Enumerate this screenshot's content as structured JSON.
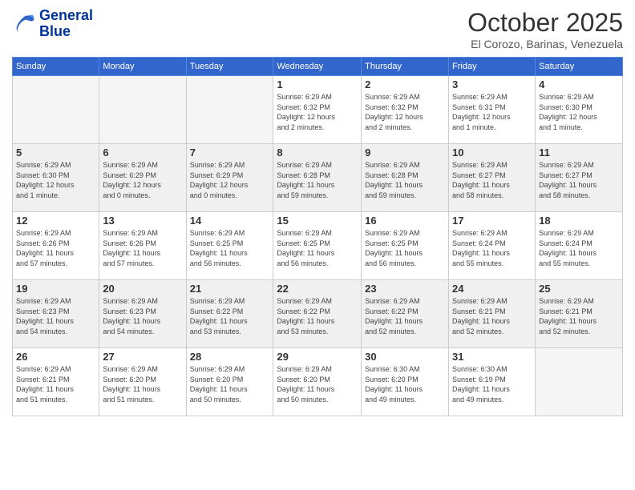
{
  "header": {
    "logo_line1": "General",
    "logo_line2": "Blue",
    "month": "October 2025",
    "location": "El Corozo, Barinas, Venezuela"
  },
  "days_of_week": [
    "Sunday",
    "Monday",
    "Tuesday",
    "Wednesday",
    "Thursday",
    "Friday",
    "Saturday"
  ],
  "weeks": [
    [
      {
        "day": "",
        "info": ""
      },
      {
        "day": "",
        "info": ""
      },
      {
        "day": "",
        "info": ""
      },
      {
        "day": "1",
        "info": "Sunrise: 6:29 AM\nSunset: 6:32 PM\nDaylight: 12 hours\nand 2 minutes."
      },
      {
        "day": "2",
        "info": "Sunrise: 6:29 AM\nSunset: 6:32 PM\nDaylight: 12 hours\nand 2 minutes."
      },
      {
        "day": "3",
        "info": "Sunrise: 6:29 AM\nSunset: 6:31 PM\nDaylight: 12 hours\nand 1 minute."
      },
      {
        "day": "4",
        "info": "Sunrise: 6:29 AM\nSunset: 6:30 PM\nDaylight: 12 hours\nand 1 minute."
      }
    ],
    [
      {
        "day": "5",
        "info": "Sunrise: 6:29 AM\nSunset: 6:30 PM\nDaylight: 12 hours\nand 1 minute."
      },
      {
        "day": "6",
        "info": "Sunrise: 6:29 AM\nSunset: 6:29 PM\nDaylight: 12 hours\nand 0 minutes."
      },
      {
        "day": "7",
        "info": "Sunrise: 6:29 AM\nSunset: 6:29 PM\nDaylight: 12 hours\nand 0 minutes."
      },
      {
        "day": "8",
        "info": "Sunrise: 6:29 AM\nSunset: 6:28 PM\nDaylight: 11 hours\nand 59 minutes."
      },
      {
        "day": "9",
        "info": "Sunrise: 6:29 AM\nSunset: 6:28 PM\nDaylight: 11 hours\nand 59 minutes."
      },
      {
        "day": "10",
        "info": "Sunrise: 6:29 AM\nSunset: 6:27 PM\nDaylight: 11 hours\nand 58 minutes."
      },
      {
        "day": "11",
        "info": "Sunrise: 6:29 AM\nSunset: 6:27 PM\nDaylight: 11 hours\nand 58 minutes."
      }
    ],
    [
      {
        "day": "12",
        "info": "Sunrise: 6:29 AM\nSunset: 6:26 PM\nDaylight: 11 hours\nand 57 minutes."
      },
      {
        "day": "13",
        "info": "Sunrise: 6:29 AM\nSunset: 6:26 PM\nDaylight: 11 hours\nand 57 minutes."
      },
      {
        "day": "14",
        "info": "Sunrise: 6:29 AM\nSunset: 6:25 PM\nDaylight: 11 hours\nand 56 minutes."
      },
      {
        "day": "15",
        "info": "Sunrise: 6:29 AM\nSunset: 6:25 PM\nDaylight: 11 hours\nand 56 minutes."
      },
      {
        "day": "16",
        "info": "Sunrise: 6:29 AM\nSunset: 6:25 PM\nDaylight: 11 hours\nand 56 minutes."
      },
      {
        "day": "17",
        "info": "Sunrise: 6:29 AM\nSunset: 6:24 PM\nDaylight: 11 hours\nand 55 minutes."
      },
      {
        "day": "18",
        "info": "Sunrise: 6:29 AM\nSunset: 6:24 PM\nDaylight: 11 hours\nand 55 minutes."
      }
    ],
    [
      {
        "day": "19",
        "info": "Sunrise: 6:29 AM\nSunset: 6:23 PM\nDaylight: 11 hours\nand 54 minutes."
      },
      {
        "day": "20",
        "info": "Sunrise: 6:29 AM\nSunset: 6:23 PM\nDaylight: 11 hours\nand 54 minutes."
      },
      {
        "day": "21",
        "info": "Sunrise: 6:29 AM\nSunset: 6:22 PM\nDaylight: 11 hours\nand 53 minutes."
      },
      {
        "day": "22",
        "info": "Sunrise: 6:29 AM\nSunset: 6:22 PM\nDaylight: 11 hours\nand 53 minutes."
      },
      {
        "day": "23",
        "info": "Sunrise: 6:29 AM\nSunset: 6:22 PM\nDaylight: 11 hours\nand 52 minutes."
      },
      {
        "day": "24",
        "info": "Sunrise: 6:29 AM\nSunset: 6:21 PM\nDaylight: 11 hours\nand 52 minutes."
      },
      {
        "day": "25",
        "info": "Sunrise: 6:29 AM\nSunset: 6:21 PM\nDaylight: 11 hours\nand 52 minutes."
      }
    ],
    [
      {
        "day": "26",
        "info": "Sunrise: 6:29 AM\nSunset: 6:21 PM\nDaylight: 11 hours\nand 51 minutes."
      },
      {
        "day": "27",
        "info": "Sunrise: 6:29 AM\nSunset: 6:20 PM\nDaylight: 11 hours\nand 51 minutes."
      },
      {
        "day": "28",
        "info": "Sunrise: 6:29 AM\nSunset: 6:20 PM\nDaylight: 11 hours\nand 50 minutes."
      },
      {
        "day": "29",
        "info": "Sunrise: 6:29 AM\nSunset: 6:20 PM\nDaylight: 11 hours\nand 50 minutes."
      },
      {
        "day": "30",
        "info": "Sunrise: 6:30 AM\nSunset: 6:20 PM\nDaylight: 11 hours\nand 49 minutes."
      },
      {
        "day": "31",
        "info": "Sunrise: 6:30 AM\nSunset: 6:19 PM\nDaylight: 11 hours\nand 49 minutes."
      },
      {
        "day": "",
        "info": ""
      }
    ]
  ]
}
